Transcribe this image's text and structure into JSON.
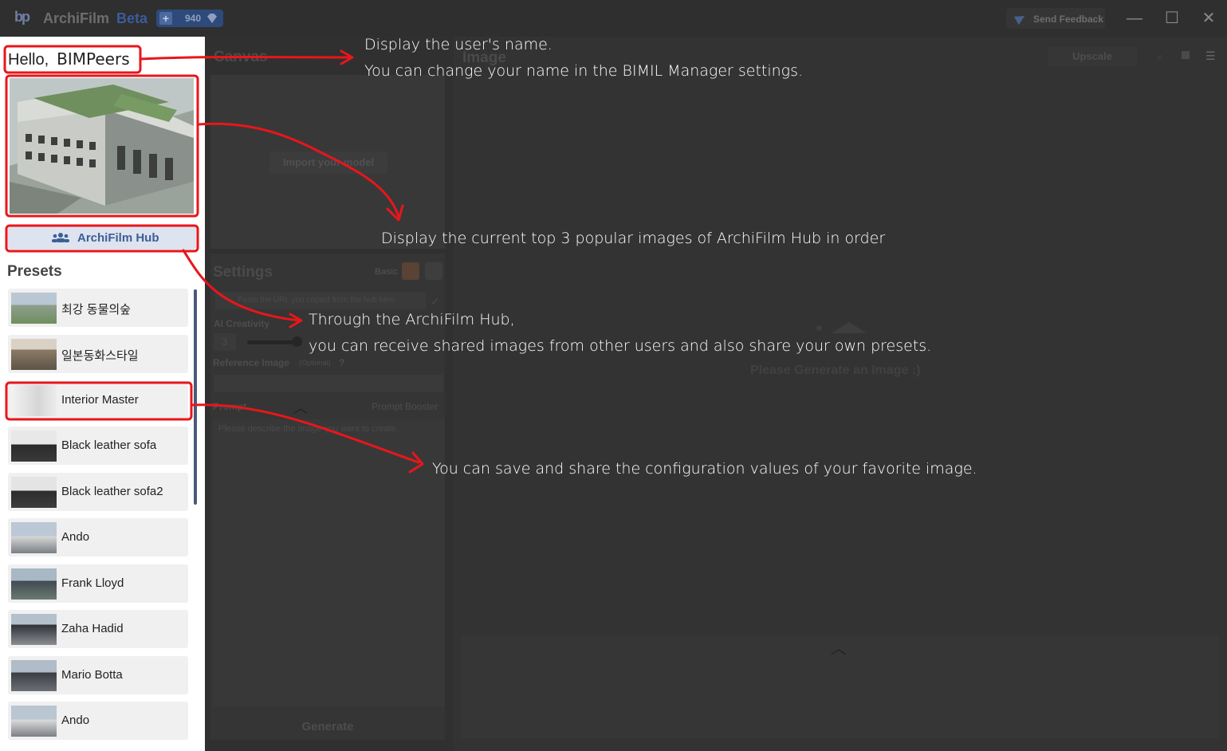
{
  "titlebar": {
    "app_name": "ArchiFilm",
    "beta": "Beta",
    "credits": "940",
    "feedback": "Send Feedback",
    "logo": "bp",
    "window_controls": {
      "minimize": "—",
      "maximize": "☐",
      "close": "✕"
    }
  },
  "left": {
    "hello": "Hello,",
    "user_name": "BIMPeers",
    "hub_button": "ArchiFilm Hub",
    "presets_title": "Presets",
    "presets": [
      {
        "label": "최강 동물의숲"
      },
      {
        "label": "일본동화스타일"
      },
      {
        "label": "Interior Master"
      },
      {
        "label": "Black leather sofa"
      },
      {
        "label": "Black leather sofa2"
      },
      {
        "label": "Ando"
      },
      {
        "label": "Frank Lloyd"
      },
      {
        "label": "Zaha Hadid"
      },
      {
        "label": "Mario Botta"
      },
      {
        "label": "Ando"
      }
    ]
  },
  "middle": {
    "canvas_title": "Canvas",
    "import_button": "Import your model",
    "settings_title": "Settings",
    "mode": "Basic",
    "url_placeholder": "Paste the URL you copied from the hub here",
    "ai_creativity": "AI Creativity",
    "ai_creativity_value": "3",
    "ai_creativity_level": 0.85,
    "reference_image": "Reference Image",
    "optional": "(Optional)",
    "prompt_title": "Prompt",
    "prompt_booster": "Prompt Booster",
    "prompt_placeholder": "Please describe the image you want to create.",
    "generate": "Generate"
  },
  "right": {
    "image_title": "Image",
    "upscale": "Upscale",
    "placeholder": "Please Generate an Image :)"
  },
  "annotations": {
    "a1_line1": "Display the user's name.",
    "a1_line2": "You can change your name in the BIMIL Manager settings.",
    "a2": "Display the current top 3 popular images of ArchiFilm Hub in order",
    "a3_line1": "Through the ArchiFilm Hub,",
    "a3_line2": "you can receive shared images from other users and also share your own presets.",
    "a4": "You can save and share the configuration values of your favorite image."
  },
  "colors": {
    "annotation_red": "#e8161b",
    "accent_blue": "#3d5e95",
    "overlay": "#333333"
  }
}
